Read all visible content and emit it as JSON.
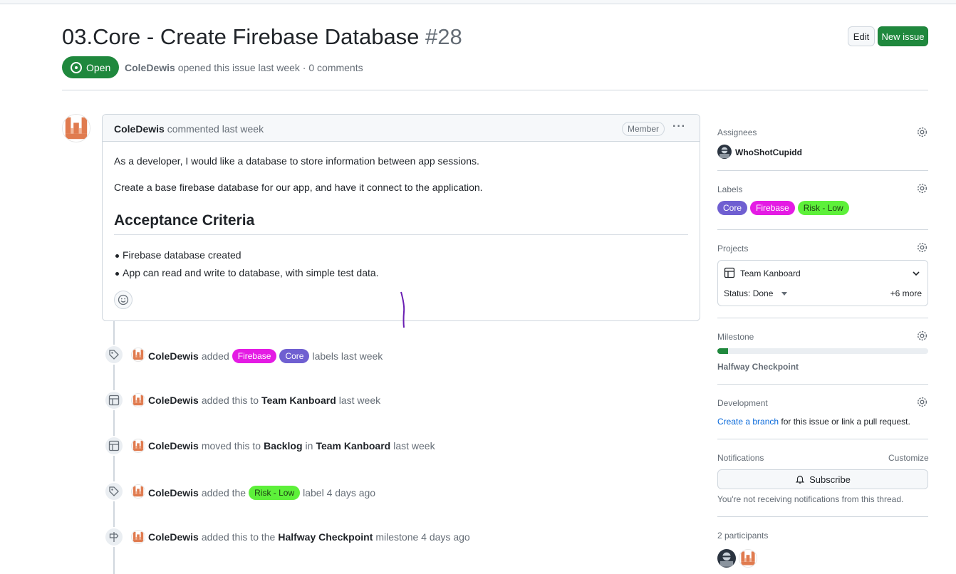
{
  "issue": {
    "title": "03.Core - Create Firebase Database",
    "number": "#28",
    "state": "Open",
    "author": "ColeDewis",
    "meta_rest": "opened this issue last week · 0 comments"
  },
  "header_buttons": {
    "edit": "Edit",
    "new_issue": "New issue"
  },
  "comment": {
    "author": "ColeDewis",
    "when": "commented last week",
    "badge": "Member",
    "menu": "···",
    "para1": "As a developer, I would like a database to store information between app sessions.",
    "para2": "Create a base firebase database for our app, and have it connect to the application.",
    "heading": "Acceptance Criteria",
    "bullets": [
      "Firebase database created",
      "App can read and write to database, with simple test data."
    ]
  },
  "timeline": [
    {
      "icon": "tag-icon",
      "actor": "ColeDewis",
      "t1": "added",
      "labels": [
        "Firebase",
        "Core"
      ],
      "t2": "labels last week"
    },
    {
      "icon": "table-icon",
      "actor": "ColeDewis",
      "t1": "added this to",
      "project": "Team Kanboard",
      "t2": "last week"
    },
    {
      "icon": "table-icon",
      "actor": "ColeDewis",
      "t1": "moved this to",
      "column": "Backlog",
      "t_in": "in",
      "project": "Team Kanboard",
      "t2": "last week"
    },
    {
      "icon": "tag-icon",
      "actor": "ColeDewis",
      "t1": "added the",
      "label": "Risk - Low",
      "t2": "label 4 days ago"
    },
    {
      "icon": "milestone-icon",
      "actor": "ColeDewis",
      "t1": "added this to the",
      "milestone": "Halfway Checkpoint",
      "t2": "milestone 4 days ago"
    }
  ],
  "sidebar": {
    "assignees": {
      "heading": "Assignees",
      "user": "WhoShotCupidd"
    },
    "labels": {
      "heading": "Labels",
      "items": [
        "Core",
        "Firebase",
        "Risk - Low"
      ]
    },
    "projects": {
      "heading": "Projects",
      "name": "Team Kanboard",
      "status": "Status: Done",
      "more": "+6 more"
    },
    "milestone": {
      "heading": "Milestone",
      "name": "Halfway Checkpoint",
      "progress": 0.05
    },
    "development": {
      "heading": "Development",
      "link": "Create a branch",
      "rest": "for this issue or link a pull request."
    },
    "notifications": {
      "heading": "Notifications",
      "customize": "Customize",
      "subscribe": "Subscribe",
      "note": "You're not receiving notifications from this thread."
    },
    "participants": {
      "heading": "2 participants"
    }
  },
  "colors": {
    "open_green": "#1f883d",
    "label_core": "#6f5fd1",
    "label_firebase": "#e41be4",
    "label_risk": "#5df03a",
    "link_blue": "#0969da"
  }
}
